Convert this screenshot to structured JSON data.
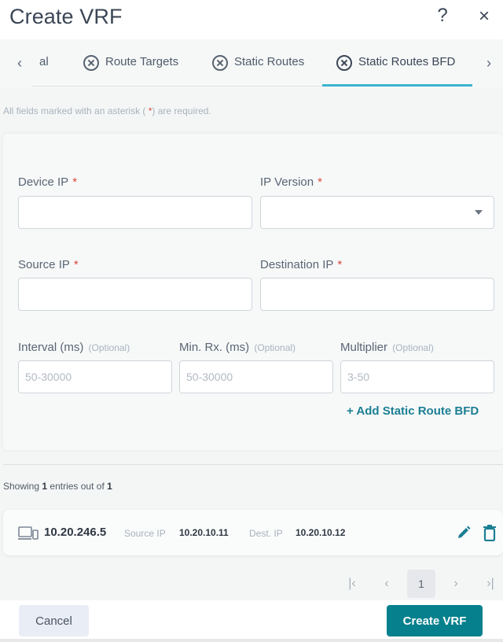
{
  "header": {
    "title": "Create VRF",
    "help_label": "?",
    "close_label": "×"
  },
  "tabs": {
    "prev_label": "‹",
    "next_label": "›",
    "items": [
      {
        "label": "al",
        "icon": "none",
        "active": false
      },
      {
        "label": "Route Targets",
        "icon": "route-target-icon",
        "active": false
      },
      {
        "label": "Static Routes",
        "icon": "route-target-icon",
        "active": false
      },
      {
        "label": "Static Routes BFD",
        "icon": "route-target-icon",
        "active": true
      }
    ]
  },
  "required_note": {
    "prefix": "All fields marked with an asterisk (",
    "star": " *",
    "suffix": ") are required."
  },
  "form": {
    "device_ip": {
      "label": "Device IP",
      "required_mark": "*",
      "value": "",
      "placeholder": ""
    },
    "ip_version": {
      "label": "IP Version",
      "required_mark": "*",
      "selected": ""
    },
    "source_ip": {
      "label": "Source IP",
      "required_mark": "*",
      "value": "",
      "placeholder": ""
    },
    "destination_ip": {
      "label": "Destination IP",
      "required_mark": "*",
      "value": "",
      "placeholder": ""
    },
    "interval": {
      "label": "Interval (ms)",
      "optional": "(Optional)",
      "value": "",
      "placeholder": "50-30000"
    },
    "min_rx": {
      "label": "Min. Rx. (ms)",
      "optional": "(Optional)",
      "value": "",
      "placeholder": "50-30000"
    },
    "multiplier": {
      "label": "Multiplier",
      "optional": "(Optional)",
      "value": "",
      "placeholder": "3-50"
    },
    "add_link": "+ Add Static Route BFD"
  },
  "list": {
    "summary_prefix": "Showing ",
    "shown": "1",
    "summary_mid": " entries out of ",
    "total": "1",
    "rows": [
      {
        "device_ip": "10.20.246.5",
        "source_label": "Source IP",
        "source_ip": "10.20.10.11",
        "dest_label": "Dest. IP",
        "dest_ip": "10.20.10.12"
      }
    ]
  },
  "pagination": {
    "first": "|‹",
    "prev": "‹",
    "current": "1",
    "next": "›",
    "last": "›|"
  },
  "footer": {
    "cancel_label": "Cancel",
    "create_label": "Create VRF"
  },
  "colors": {
    "accent": "#07808d",
    "tab_underline": "#3bb3cf",
    "required_star": "#d64a3a",
    "link": "#1b7f93"
  }
}
